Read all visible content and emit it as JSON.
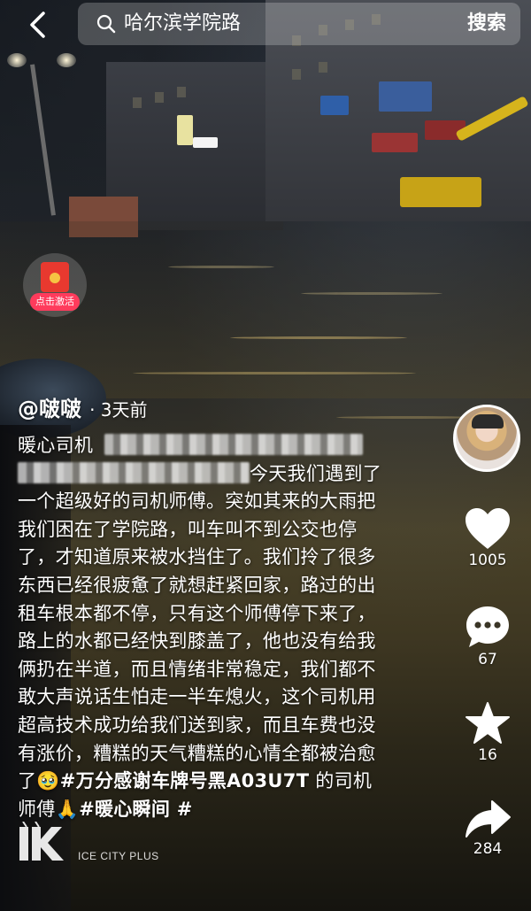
{
  "topbar": {
    "back_icon": "chevron-left-icon",
    "search_icon": "search-icon",
    "query": "哈尔滨学院路",
    "search_button": "搜索"
  },
  "promo_badge": {
    "icon": "red-envelope-icon",
    "label": "点击激活"
  },
  "post": {
    "author": "@啵啵",
    "time_ago": "· 3天前",
    "caption": {
      "line1_prefix": "暖心司机",
      "line2_suffix": "今天我们遇到",
      "body": "了一个超级好的司机师傅。突如其来的大雨把我们困在了学院路，叫车叫不到公交也停了，才知道原来被水挡住了。我们拎了很多东西已经很疲惫了就想赶紧回家，路过的出租车根本都不停，只有这个师傅停下来了，路上的水都已经快到膝盖了，他也没有给我俩扔在半道，而且情绪非常稳定，我们都不敢大声说话生怕走一半车熄火，这个司机用超高技术成功给我们送到家，而且车费也没有涨价，糟糕的天气糟糕的心情全都被治愈了",
      "emoji": "🥹",
      "tag1": "#万分感谢车牌号黑A03U7T",
      "tail": " 的司机师傅",
      "emoji2": "🙏",
      "tag2": "#暖心瞬间 #"
    }
  },
  "actions": {
    "like": {
      "icon": "heart-icon",
      "count": "1005"
    },
    "comment": {
      "icon": "comment-bubble-icon",
      "count": "67"
    },
    "favorite": {
      "icon": "star-icon",
      "count": "16"
    },
    "share": {
      "icon": "share-arrow-icon",
      "count": "284"
    }
  },
  "watermark": {
    "logo": "ice-city-logo",
    "text": "ICE CITY PLUS"
  }
}
